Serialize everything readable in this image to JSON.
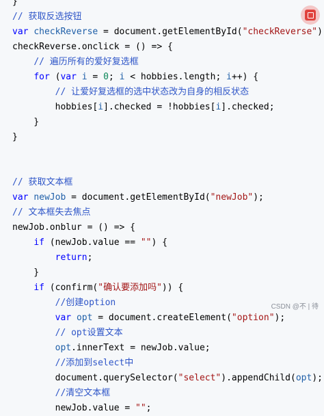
{
  "code": {
    "lines": [
      [
        {
          "t": "}",
          "c": "plain"
        }
      ],
      [
        {
          "t": "// 获取反选按钮",
          "c": "cm"
        }
      ],
      [
        {
          "t": "var ",
          "c": "kw"
        },
        {
          "t": "checkReverse",
          "c": "var"
        },
        {
          "t": " = document.getElementById(",
          "c": "plain"
        },
        {
          "t": "\"checkReverse\"",
          "c": "str"
        },
        {
          "t": ");",
          "c": "plain"
        }
      ],
      [
        {
          "t": "checkReverse.onclick = () => {",
          "c": "plain"
        }
      ],
      [
        {
          "t": "    ",
          "c": "plain"
        },
        {
          "t": "// 遍历所有的爱好复选框",
          "c": "cm"
        }
      ],
      [
        {
          "t": "    ",
          "c": "plain"
        },
        {
          "t": "for ",
          "c": "kw"
        },
        {
          "t": "(",
          "c": "plain"
        },
        {
          "t": "var ",
          "c": "kw"
        },
        {
          "t": "i",
          "c": "var"
        },
        {
          "t": " = ",
          "c": "plain"
        },
        {
          "t": "0",
          "c": "num"
        },
        {
          "t": "; ",
          "c": "plain"
        },
        {
          "t": "i",
          "c": "var"
        },
        {
          "t": " < hobbies.length; ",
          "c": "plain"
        },
        {
          "t": "i",
          "c": "var"
        },
        {
          "t": "++) {",
          "c": "plain"
        }
      ],
      [
        {
          "t": "        ",
          "c": "plain"
        },
        {
          "t": "// 让爱好复选框的选中状态改为自身的相反状态",
          "c": "cm"
        }
      ],
      [
        {
          "t": "        hobbies[",
          "c": "plain"
        },
        {
          "t": "i",
          "c": "var"
        },
        {
          "t": "].checked = !hobbies[",
          "c": "plain"
        },
        {
          "t": "i",
          "c": "var"
        },
        {
          "t": "].checked;",
          "c": "plain"
        }
      ],
      [
        {
          "t": "    }",
          "c": "plain"
        }
      ],
      [
        {
          "t": "}",
          "c": "plain"
        }
      ],
      [],
      [],
      [
        {
          "t": "// 获取文本框",
          "c": "cm"
        }
      ],
      [
        {
          "t": "var ",
          "c": "kw"
        },
        {
          "t": "newJob",
          "c": "var"
        },
        {
          "t": " = document.getElementById(",
          "c": "plain"
        },
        {
          "t": "\"newJob\"",
          "c": "str"
        },
        {
          "t": ");",
          "c": "plain"
        }
      ],
      [
        {
          "t": "// 文本框失去焦点",
          "c": "cm"
        }
      ],
      [
        {
          "t": "newJob.onblur = () => {",
          "c": "plain"
        }
      ],
      [
        {
          "t": "    ",
          "c": "plain"
        },
        {
          "t": "if ",
          "c": "kw"
        },
        {
          "t": "(newJob.value == ",
          "c": "plain"
        },
        {
          "t": "\"\"",
          "c": "str"
        },
        {
          "t": ") {",
          "c": "plain"
        }
      ],
      [
        {
          "t": "        ",
          "c": "plain"
        },
        {
          "t": "return",
          "c": "kw"
        },
        {
          "t": ";",
          "c": "plain"
        }
      ],
      [
        {
          "t": "    }",
          "c": "plain"
        }
      ],
      [
        {
          "t": "    ",
          "c": "plain"
        },
        {
          "t": "if ",
          "c": "kw"
        },
        {
          "t": "(confirm(",
          "c": "plain"
        },
        {
          "t": "\"确认要添加吗\"",
          "c": "str"
        },
        {
          "t": ")) {",
          "c": "plain"
        }
      ],
      [
        {
          "t": "        ",
          "c": "plain"
        },
        {
          "t": "//创建option",
          "c": "cm"
        }
      ],
      [
        {
          "t": "        ",
          "c": "plain"
        },
        {
          "t": "var ",
          "c": "kw"
        },
        {
          "t": "opt",
          "c": "var"
        },
        {
          "t": " = document.createElement(",
          "c": "plain"
        },
        {
          "t": "\"option\"",
          "c": "str"
        },
        {
          "t": ");",
          "c": "plain"
        }
      ],
      [
        {
          "t": "        ",
          "c": "plain"
        },
        {
          "t": "// opt设置文本",
          "c": "cm"
        }
      ],
      [
        {
          "t": "        ",
          "c": "plain"
        },
        {
          "t": "opt",
          "c": "var"
        },
        {
          "t": ".innerText = newJob.value;",
          "c": "plain"
        }
      ],
      [
        {
          "t": "        ",
          "c": "plain"
        },
        {
          "t": "//添加到select中",
          "c": "cm"
        }
      ],
      [
        {
          "t": "        document.querySelector(",
          "c": "plain"
        },
        {
          "t": "\"select\"",
          "c": "str"
        },
        {
          "t": ").appendChild(",
          "c": "plain"
        },
        {
          "t": "opt",
          "c": "var"
        },
        {
          "t": ");",
          "c": "plain"
        }
      ],
      [
        {
          "t": "        ",
          "c": "plain"
        },
        {
          "t": "//清空文本框",
          "c": "cm"
        }
      ],
      [
        {
          "t": "        newJob.value = ",
          "c": "plain"
        },
        {
          "t": "\"\"",
          "c": "str"
        },
        {
          "t": ";",
          "c": "plain"
        }
      ]
    ]
  },
  "toolbar": {
    "copy_icon": "copy-icon"
  },
  "watermark": {
    "text": "CSDN @不 | 待"
  }
}
